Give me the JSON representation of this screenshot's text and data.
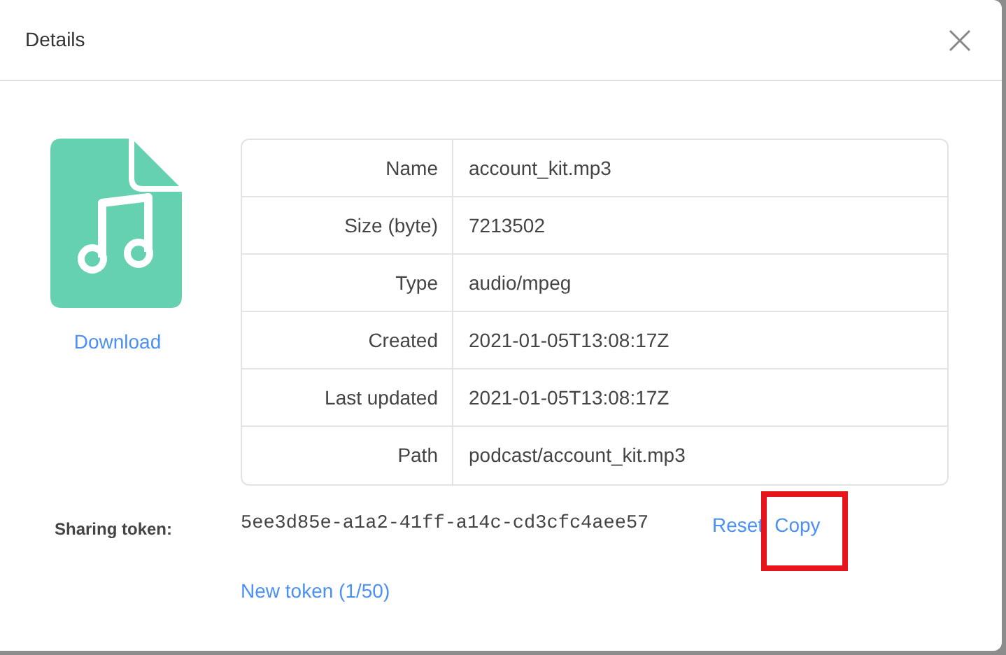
{
  "dialog": {
    "title": "Details"
  },
  "file": {
    "download_label": "Download"
  },
  "properties": [
    {
      "label": "Name",
      "value": "account_kit.mp3"
    },
    {
      "label": "Size (byte)",
      "value": "7213502"
    },
    {
      "label": "Type",
      "value": "audio/mpeg"
    },
    {
      "label": "Created",
      "value": "2021-01-05T13:08:17Z"
    },
    {
      "label": "Last updated",
      "value": "2021-01-05T13:08:17Z"
    },
    {
      "label": "Path",
      "value": "podcast/account_kit.mp3"
    }
  ],
  "sharing": {
    "label": "Sharing token:",
    "token": "5ee3d85e-a1a2-41ff-a14c-cd3cfc4aee57",
    "new_token": "New token (1/50)",
    "actions": [
      {
        "label": "Reset",
        "highlighted": false
      },
      {
        "label": "Copy",
        "highlighted": true
      }
    ]
  }
}
